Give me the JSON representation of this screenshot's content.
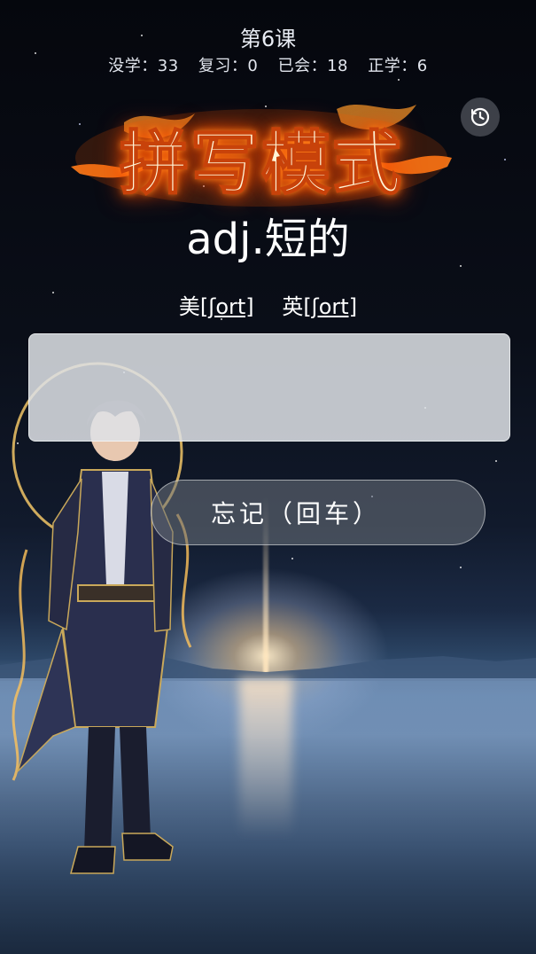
{
  "header": {
    "lesson_title": "第6课"
  },
  "stats": [
    {
      "label": "没学",
      "value": "33"
    },
    {
      "label": "复习",
      "value": "0"
    },
    {
      "label": "已会",
      "value": "18"
    },
    {
      "label": "正学",
      "value": "6"
    }
  ],
  "logo": {
    "text": "拼写模式"
  },
  "word": {
    "meaning": "adj.短的"
  },
  "phonetics": {
    "us_label": "美",
    "us_ipa": "[ʃort]",
    "uk_label": "英",
    "uk_ipa": "[ʃort]"
  },
  "answer": {
    "value": "",
    "placeholder": ""
  },
  "buttons": {
    "forget_label": "忘记（回车）",
    "history_icon": "history-clock-icon"
  },
  "colors": {
    "logo_fire": "#ff6a00",
    "input_bg": "#dee2e6",
    "button_bg": "#6e747e"
  }
}
